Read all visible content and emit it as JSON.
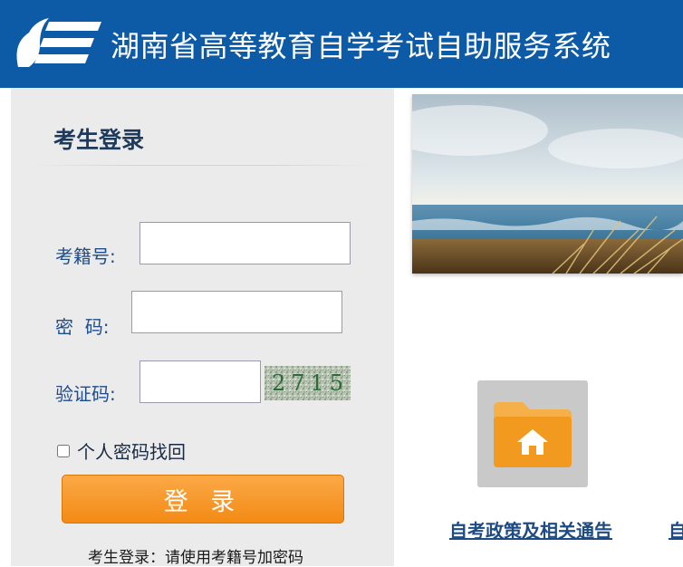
{
  "header": {
    "title": "湖南省高等教育自学考试自助服务系统",
    "logo_icon": "ze-logo-icon",
    "background": "#0d5aa7"
  },
  "login": {
    "heading": "考生登录",
    "exam_number_label": "考籍号:",
    "exam_number_value": "",
    "password_label": "密  码:",
    "password_value": "",
    "captcha_label": "验证码:",
    "captcha_value": "",
    "captcha_image_text": "2715",
    "recover_password_label": "个人密码找回",
    "recover_password_checked": false,
    "login_button": "登 录",
    "hint": "考生登录：请使用考籍号加密码",
    "button_color": "#f69320"
  },
  "content": {
    "tile_icon": "home-folder-icon",
    "links": [
      {
        "label": "自考政策及相关通告"
      },
      {
        "label": "自"
      }
    ]
  }
}
